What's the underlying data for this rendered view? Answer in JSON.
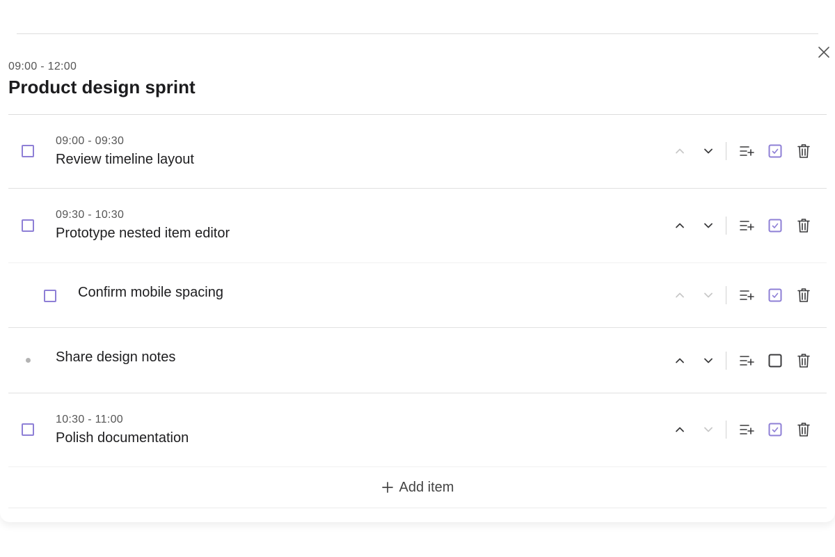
{
  "header": {
    "time_range": "09:00 - 12:00",
    "title": "Product design sprint"
  },
  "items": [
    {
      "kind": "task",
      "time": "09:00 - 09:30",
      "label": "Review timeline layout",
      "up_enabled": false,
      "down_enabled": true,
      "is_task": true,
      "nested": false
    },
    {
      "kind": "task",
      "time": "09:30 - 10:30",
      "label": "Prototype nested item editor",
      "up_enabled": true,
      "down_enabled": true,
      "is_task": true,
      "nested": false
    },
    {
      "kind": "subtask",
      "time": "",
      "label": "Confirm mobile spacing",
      "up_enabled": false,
      "down_enabled": false,
      "is_task": true,
      "nested": true
    },
    {
      "kind": "note",
      "time": "",
      "label": "Share design notes",
      "up_enabled": true,
      "down_enabled": true,
      "is_task": false,
      "nested": false
    },
    {
      "kind": "task",
      "time": "10:30 - 11:00",
      "label": "Polish documentation",
      "up_enabled": true,
      "down_enabled": false,
      "is_task": true,
      "nested": false
    }
  ],
  "add_item": {
    "icon": "plus-icon",
    "label": "Add item"
  },
  "icons": {
    "close": "close-icon",
    "move_up": "chevron-up-icon",
    "move_down": "chevron-down-icon",
    "add_subitem": "add-subitem-icon",
    "task_toggle": "checkbox-toggle-icon",
    "delete": "trash-icon"
  },
  "colors": {
    "accent": "#8e7fd6",
    "text": "#1d1d1f",
    "muted": "#555555",
    "icon": "#3a3a3c",
    "icon_disabled": "#c8c8c8",
    "divider": "#e1e1e1"
  }
}
